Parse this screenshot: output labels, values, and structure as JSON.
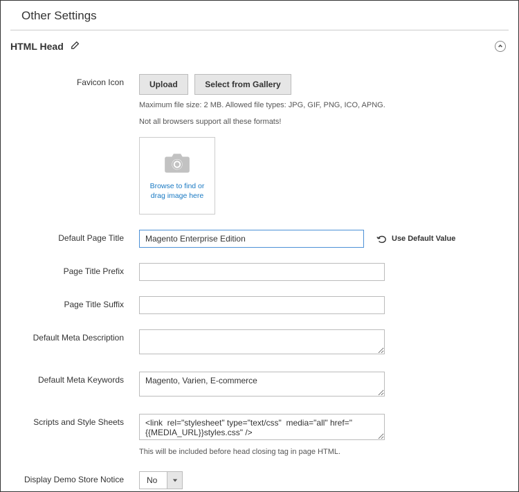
{
  "page_title": "Other Settings",
  "section": {
    "title": "HTML Head"
  },
  "favicon": {
    "label": "Favicon Icon",
    "upload_label": "Upload",
    "gallery_label": "Select from Gallery",
    "hint1": "Maximum file size: 2 MB. Allowed file types: JPG, GIF, PNG, ICO, APNG.",
    "hint2": "Not all browsers support all these formats!",
    "browse_text": "Browse to find or drag image here"
  },
  "default_page_title": {
    "label": "Default Page Title",
    "value": "Magento Enterprise Edition",
    "use_default_label": "Use Default Value"
  },
  "page_title_prefix": {
    "label": "Page Title Prefix",
    "value": ""
  },
  "page_title_suffix": {
    "label": "Page Title Suffix",
    "value": ""
  },
  "meta_description": {
    "label": "Default Meta Description",
    "value": ""
  },
  "meta_keywords": {
    "label": "Default Meta Keywords",
    "value": "Magento, Varien, E-commerce"
  },
  "scripts": {
    "label": "Scripts and Style Sheets",
    "value": "<link  rel=\"stylesheet\" type=\"text/css\"  media=\"all\" href=\"{{MEDIA_URL}}styles.css\" />",
    "hint": "This will be included before head closing tag in page HTML."
  },
  "demo_notice": {
    "label": "Display Demo Store Notice",
    "value": "No"
  }
}
